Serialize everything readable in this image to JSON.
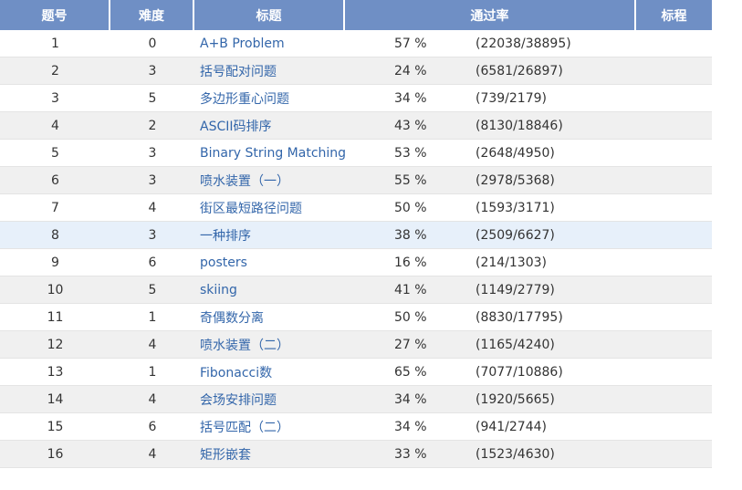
{
  "header": {
    "num": "题号",
    "difficulty": "难度",
    "title": "标题",
    "pass_rate": "通过率",
    "tag": "标程"
  },
  "rows": [
    {
      "num": "1",
      "diff": "0",
      "title": "A+B Problem",
      "pct": "57 %",
      "count": "(22038/38895)"
    },
    {
      "num": "2",
      "diff": "3",
      "title": "括号配对问题",
      "pct": "24 %",
      "count": "(6581/26897)"
    },
    {
      "num": "3",
      "diff": "5",
      "title": "多边形重心问题",
      "pct": "34 %",
      "count": "(739/2179)"
    },
    {
      "num": "4",
      "diff": "2",
      "title": "ASCII码排序",
      "pct": "43 %",
      "count": "(8130/18846)"
    },
    {
      "num": "5",
      "diff": "3",
      "title": "Binary String Matching",
      "pct": "53 %",
      "count": "(2648/4950)"
    },
    {
      "num": "6",
      "diff": "3",
      "title": "喷水装置（一）",
      "pct": "55 %",
      "count": "(2978/5368)"
    },
    {
      "num": "7",
      "diff": "4",
      "title": "街区最短路径问题",
      "pct": "50 %",
      "count": "(1593/3171)"
    },
    {
      "num": "8",
      "diff": "3",
      "title": "一种排序",
      "pct": "38 %",
      "count": "(2509/6627)"
    },
    {
      "num": "9",
      "diff": "6",
      "title": "posters",
      "pct": "16 %",
      "count": "(214/1303)"
    },
    {
      "num": "10",
      "diff": "5",
      "title": "skiing",
      "pct": "41 %",
      "count": "(1149/2779)"
    },
    {
      "num": "11",
      "diff": "1",
      "title": "奇偶数分离",
      "pct": "50 %",
      "count": "(8830/17795)"
    },
    {
      "num": "12",
      "diff": "4",
      "title": "喷水装置（二）",
      "pct": "27 %",
      "count": "(1165/4240)"
    },
    {
      "num": "13",
      "diff": "1",
      "title": "Fibonacci数",
      "pct": "65 %",
      "count": "(7077/10886)"
    },
    {
      "num": "14",
      "diff": "4",
      "title": "会场安排问题",
      "pct": "34 %",
      "count": "(1920/5665)"
    },
    {
      "num": "15",
      "diff": "6",
      "title": "括号匹配（二）",
      "pct": "34 %",
      "count": "(941/2744)"
    },
    {
      "num": "16",
      "diff": "4",
      "title": "矩形嵌套",
      "pct": "33 %",
      "count": "(1523/4630)"
    }
  ]
}
